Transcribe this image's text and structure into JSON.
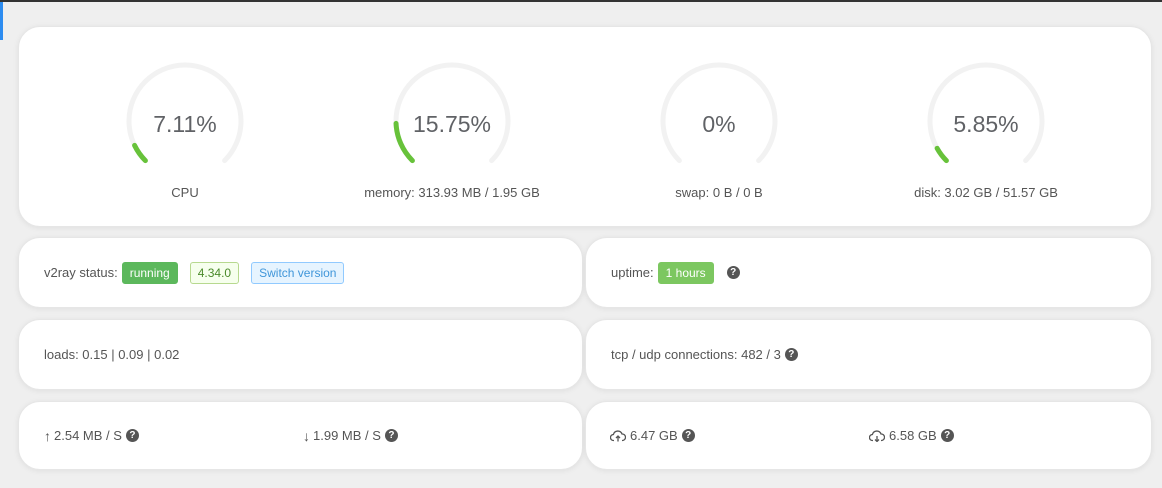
{
  "gauges": [
    {
      "value_text": "7.11%",
      "label": "CPU",
      "percent": 7.11
    },
    {
      "value_text": "15.75%",
      "label": "memory: 313.93 MB / 1.95 GB",
      "percent": 15.75
    },
    {
      "value_text": "0%",
      "label": "swap: 0 B / 0 B",
      "percent": 0
    },
    {
      "value_text": "5.85%",
      "label": "disk: 3.02 GB / 51.57 GB",
      "percent": 5.85
    }
  ],
  "colors": {
    "accent": "#67c23a",
    "track": "#f2f2f2"
  },
  "v2ray": {
    "label": "v2ray status:",
    "status": "running",
    "version": "4.34.0",
    "switch_label": "Switch version"
  },
  "uptime": {
    "label": "uptime:",
    "value": "1 hours"
  },
  "loads": {
    "text": "loads: 0.15 | 0.09 | 0.02"
  },
  "connections": {
    "text": "tcp / udp connections: 482 / 3"
  },
  "speed": {
    "up": "2.54 MB / S",
    "down": "1.99 MB / S"
  },
  "traffic": {
    "upload": "6.47 GB",
    "download": "6.58 GB"
  },
  "icons": {
    "help": "?",
    "up_arrow": "↑",
    "down_arrow": "↓"
  }
}
